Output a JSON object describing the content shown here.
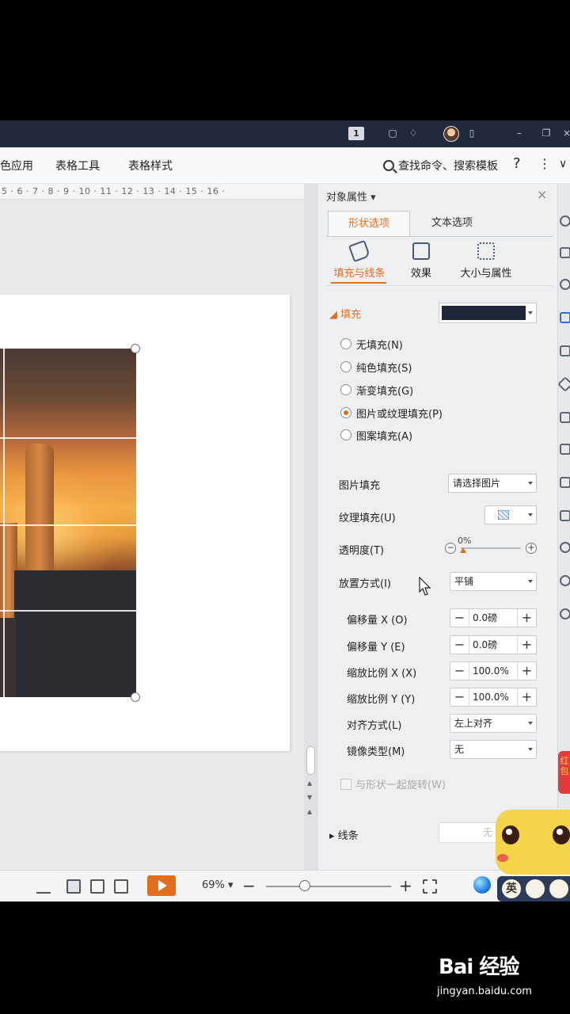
{
  "titlebar": {
    "page_badge": "1"
  },
  "ribbon": {
    "tabs": [
      "色应用",
      "表格工具",
      "表格样式"
    ],
    "search_label": "查找命令、搜索模板",
    "help": "?",
    "more": "⋮",
    "collapse": "∨"
  },
  "ruler": {
    "text": "5 · 6 · 7 · 8 · 9 · 10 · 11 · 12 · 13 · 14 · 15 · 16 ·"
  },
  "panel": {
    "title": "对象属性 ▾",
    "close": "×",
    "tabs": {
      "shape": "形状选项",
      "text": "文本选项"
    },
    "subtabs": {
      "fill_line": "填充与线条",
      "effect": "效果",
      "size": "大小与属性"
    },
    "fill": {
      "heading": "◢ 填充",
      "swatch_color": "#1c2838",
      "options": [
        {
          "label": "无填充(N)",
          "selected": false
        },
        {
          "label": "纯色填充(S)",
          "selected": false
        },
        {
          "label": "渐变填充(G)",
          "selected": false
        },
        {
          "label": "图片或纹理填充(P)",
          "selected": true
        },
        {
          "label": "图案填充(A)",
          "selected": false
        }
      ]
    },
    "props": {
      "picture_fill_label": "图片填充",
      "picture_fill_value": "请选择图片",
      "texture_label": "纹理填充(U)",
      "transparency_label": "透明度(T)",
      "transparency_value": "0%",
      "transparency_level": 0,
      "placement_label": "放置方式(I)",
      "placement_value": "平铺",
      "offset_x_label": "偏移量 X (O)",
      "offset_x_value": "0.0磅",
      "offset_y_label": "偏移量 Y (E)",
      "offset_y_value": "0.0磅",
      "scale_x_label": "缩放比例 X (X)",
      "scale_x_value": "100.0%",
      "scale_y_label": "缩放比例 Y (Y)",
      "scale_y_value": "100.0%",
      "align_label": "对齐方式(L)",
      "align_value": "左上对齐",
      "mirror_label": "镜像类型(M)",
      "mirror_value": "无",
      "rotate_label": "与形状一起旋转(W)",
      "minus": "−",
      "plus": "+"
    },
    "line": {
      "heading": "▸ 线条",
      "value": "无"
    }
  },
  "right_bar": {
    "redpacket": "红包"
  },
  "statusbar": {
    "zoom_value": "69% ▾",
    "zoom_minus": "−",
    "zoom_plus": "+"
  },
  "ime": {
    "lang": "英"
  },
  "watermark": {
    "logo": "Bai 经验",
    "url": "jingyan.baidu.com"
  },
  "colors": {
    "accent": "#e46d1c",
    "titlebar": "#1f2a3a"
  }
}
